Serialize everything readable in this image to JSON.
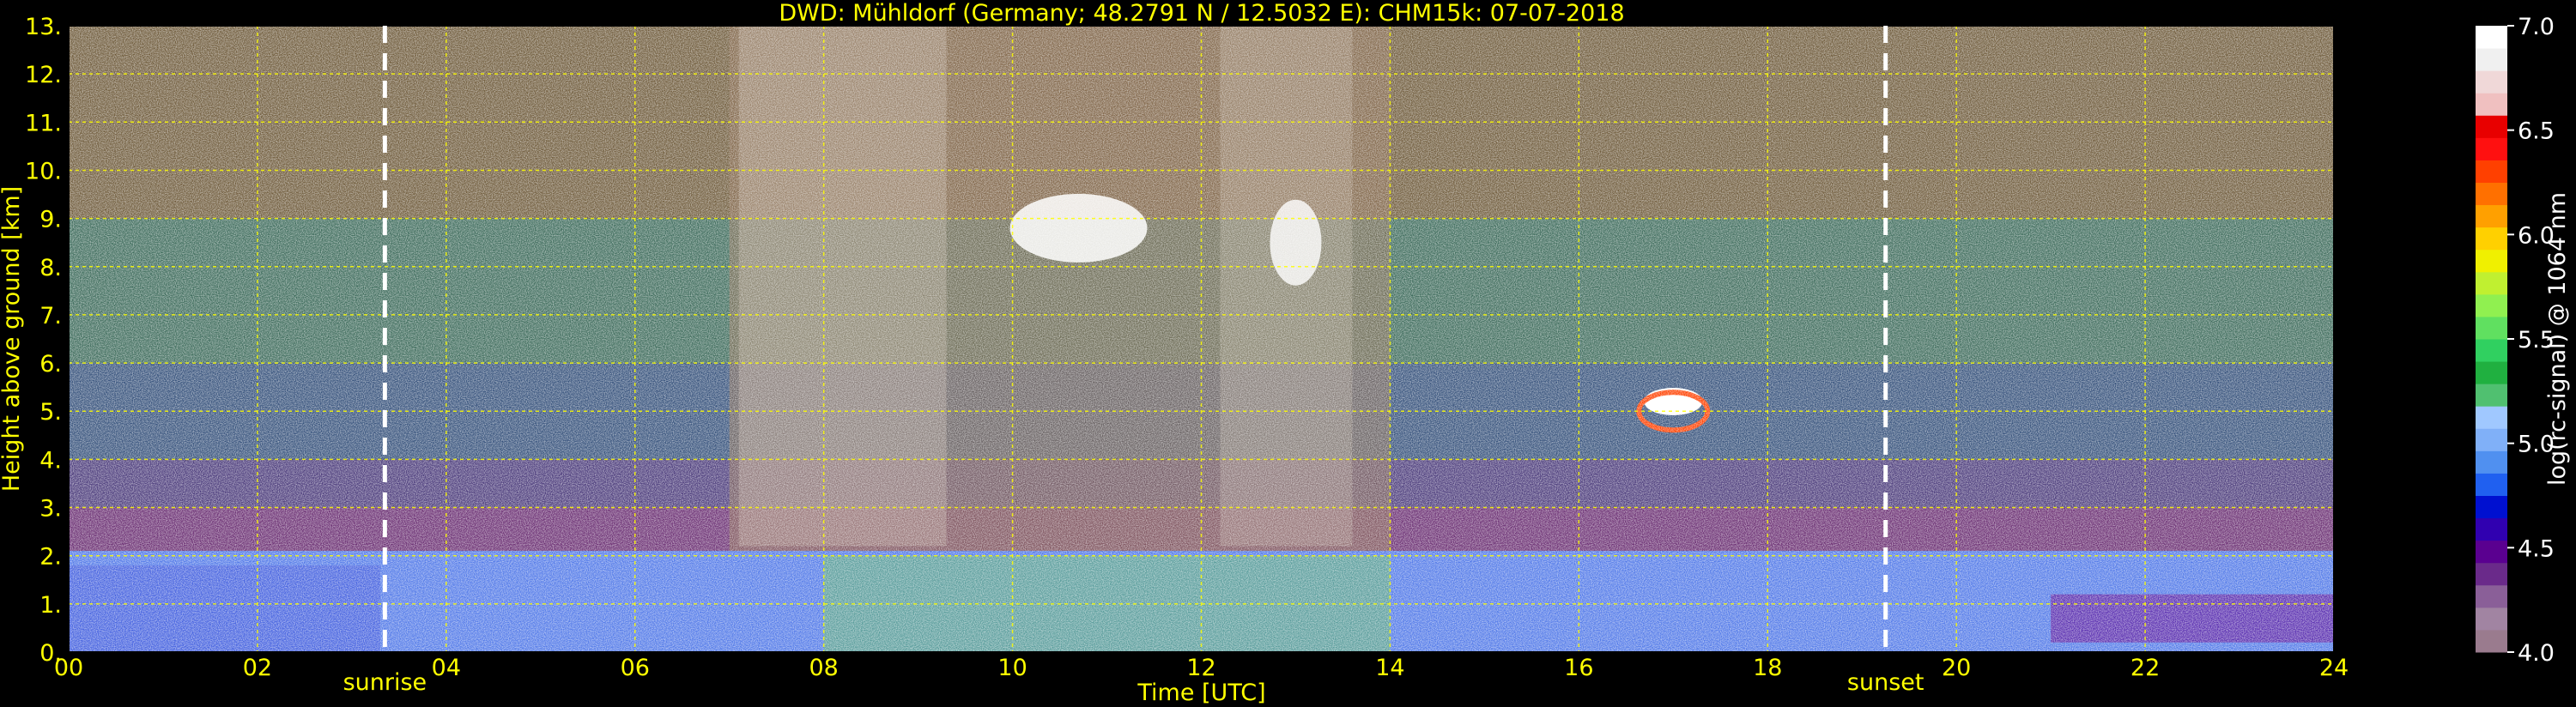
{
  "chart_data": {
    "type": "heatmap",
    "title": "DWD: Mühldorf (Germany; 48.2791 N / 12.5032 E):    CHM15k: 07-07-2018",
    "xlabel": "Time [UTC]",
    "ylabel": "Height above ground [km]",
    "xlim": [
      0,
      24
    ],
    "ylim": [
      0,
      13
    ],
    "x_ticks": [
      "00",
      "02",
      "04",
      "06",
      "08",
      "10",
      "12",
      "14",
      "16",
      "18",
      "20",
      "22",
      "24"
    ],
    "y_ticks": [
      "0.",
      "1.",
      "2.",
      "3.",
      "4.",
      "5.",
      "6.",
      "7.",
      "8.",
      "9.",
      "10.",
      "11.",
      "12.",
      "13."
    ],
    "grid": true,
    "grid_color": "#ffff00",
    "annotations": [
      {
        "label": "sunrise",
        "x": 3.35
      },
      {
        "label": "sunset",
        "x": 19.25
      }
    ],
    "colorbar": {
      "label": "log(rc-signal) @ 1064 nm",
      "range": [
        4.0,
        7.0
      ],
      "ticks": [
        "4.0",
        "4.5",
        "5.0",
        "5.5",
        "6.0",
        "6.5",
        "7.0"
      ],
      "colors": [
        "#9a7b8e",
        "#a184a2",
        "#8a5f98",
        "#6a2a8a",
        "#5a0090",
        "#3000b0",
        "#0010d0",
        "#2060f0",
        "#5090f0",
        "#80b0f8",
        "#a0c8ff",
        "#50c070",
        "#20b040",
        "#30d060",
        "#60e060",
        "#90f050",
        "#c0f030",
        "#f0f000",
        "#ffd000",
        "#ffa000",
        "#ff7000",
        "#ff4000",
        "#ff1010",
        "#e80000",
        "#f0c0c0",
        "#f0d8d8",
        "#f0f0f0",
        "#ffffff"
      ]
    }
  }
}
